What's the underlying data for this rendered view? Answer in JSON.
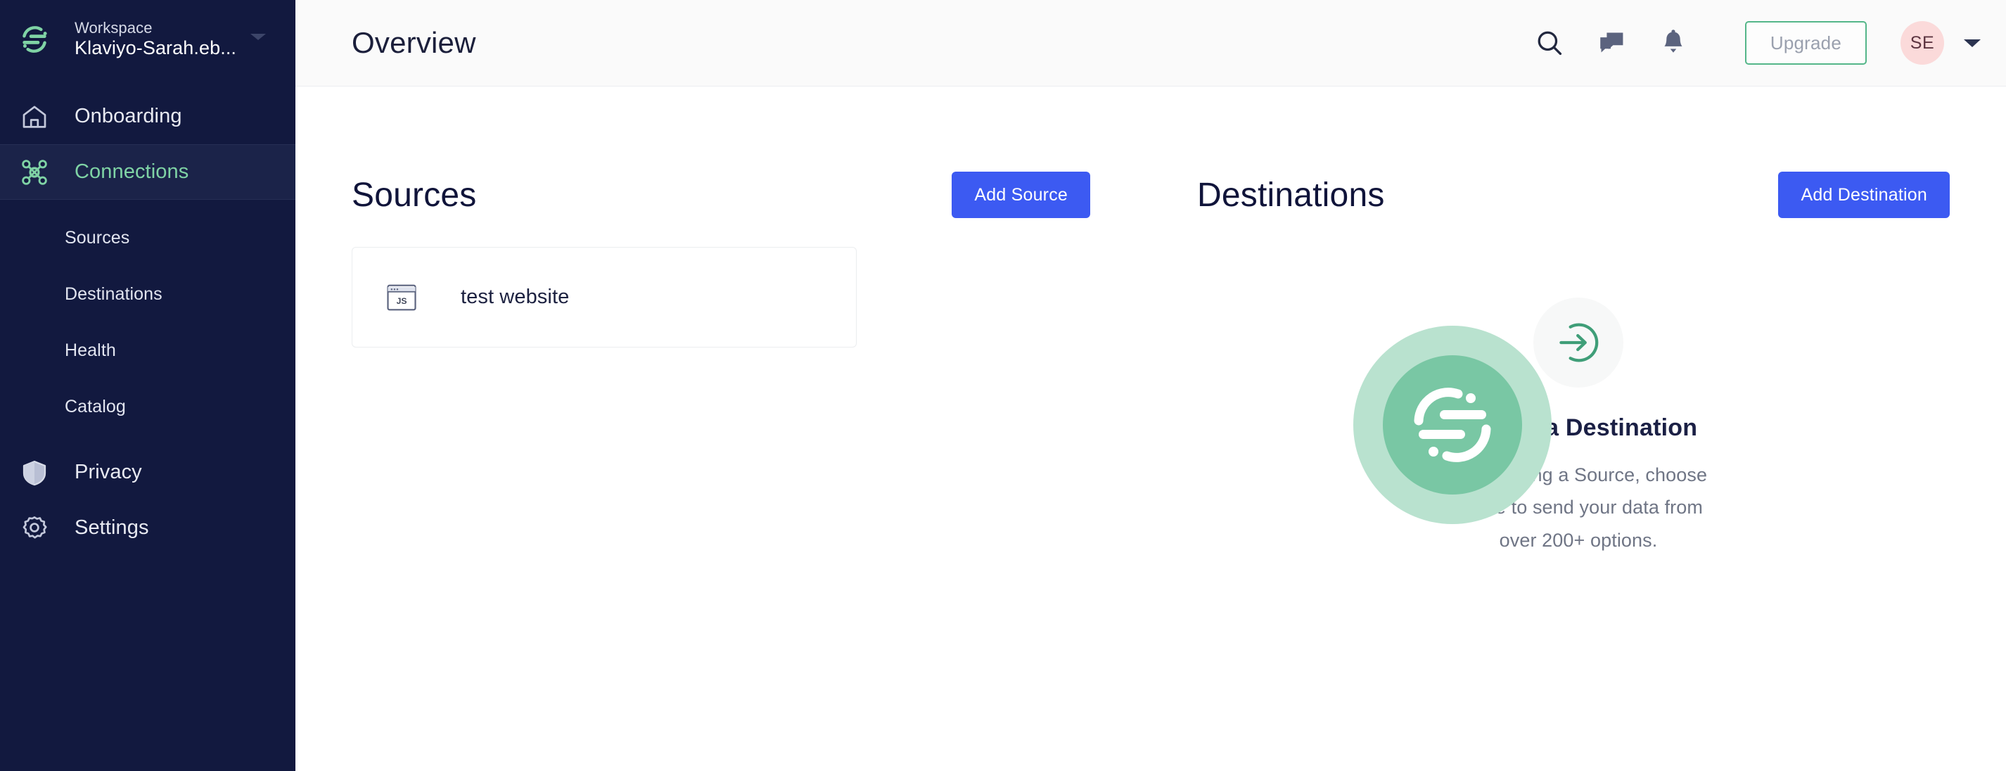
{
  "sidebar": {
    "logo_icon": "segment-logo-icon",
    "workspace_label": "Workspace",
    "workspace_name": "Klaviyo-Sarah.eb...",
    "workspace_caret_icon": "caret-down-icon",
    "items": [
      {
        "label": "Onboarding",
        "icon": "home-icon",
        "active": false
      },
      {
        "label": "Connections",
        "icon": "connections-icon",
        "active": true
      },
      {
        "label": "Privacy",
        "icon": "shield-icon",
        "active": false
      },
      {
        "label": "Settings",
        "icon": "gear-icon",
        "active": false
      }
    ],
    "sub_items": [
      {
        "label": "Sources"
      },
      {
        "label": "Destinations"
      },
      {
        "label": "Health"
      },
      {
        "label": "Catalog"
      }
    ]
  },
  "topbar": {
    "title": "Overview",
    "search_icon": "search-icon",
    "chat_icon": "chat-bubbles-icon",
    "bell_icon": "bell-icon",
    "upgrade_label": "Upgrade",
    "avatar_initials": "SE",
    "avatar_caret_icon": "caret-down-icon"
  },
  "sources": {
    "title": "Sources",
    "add_button_label": "Add Source",
    "cards": [
      {
        "name": "test website",
        "icon": "javascript-browser-icon",
        "icon_label": "JS"
      }
    ]
  },
  "destinations": {
    "title": "Destinations",
    "add_button_label": "Add Destination",
    "empty_icon": "arrow-into-circle-icon",
    "empty_title": "Enable a Destination",
    "empty_description": "After adding a Source, choose where to send your data from over 200+ options."
  },
  "brand": {
    "center_logo_icon": "segment-logo-icon",
    "primary_blue": "#3c5af2",
    "accent_green": "#54b689",
    "sidebar_navy": "#12193f",
    "avatar_pink": "#fbdada"
  }
}
